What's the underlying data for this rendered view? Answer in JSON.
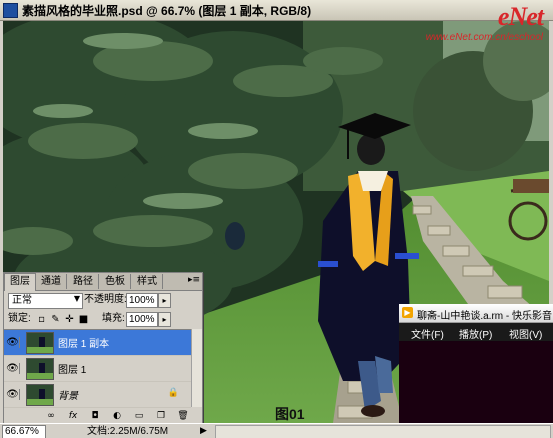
{
  "window": {
    "title": "素描风格的毕业照.psd @ 66.7% (图层 1 副本, RGB/8)"
  },
  "watermark": {
    "brand": "eNet",
    "url": "www.eNet.com.cn/eschool"
  },
  "canvas": {
    "figure_label": "图01"
  },
  "statusbar": {
    "zoom": "66.67%",
    "doc_info": "文档:2.25M/6.75M",
    "nav_arrow": "▶"
  },
  "layers_panel": {
    "tabs": [
      {
        "label": "图层"
      },
      {
        "label": "通道"
      },
      {
        "label": "路径"
      },
      {
        "label": "色板"
      },
      {
        "label": "样式"
      }
    ],
    "menu_icon": "▸≡",
    "blend_mode": "正常",
    "opacity_label": "不透明度:",
    "opacity_value": "100%",
    "lock_label": "锁定:",
    "fill_label": "填充:",
    "fill_value": "100%",
    "layers": [
      {
        "name": "图层 1 副本",
        "selected": true
      },
      {
        "name": "图层 1",
        "selected": false
      },
      {
        "name": "背景",
        "selected": false,
        "locked": true
      }
    ],
    "bottom_icons": [
      "link-icon",
      "fx-icon",
      "mask-icon",
      "adjustment-icon",
      "folder-icon",
      "new-layer-icon",
      "trash-icon"
    ]
  },
  "player": {
    "title": "聊斋-山中艳谈.a.rm - 快乐影音",
    "menu": [
      {
        "label": "文件(F)"
      },
      {
        "label": "播放(P)"
      },
      {
        "label": "视图(V)"
      }
    ]
  },
  "colors": {
    "selection": "#3c78d8",
    "watermark_red": "#d8262a",
    "panel_gray": "#d4d0c8"
  }
}
